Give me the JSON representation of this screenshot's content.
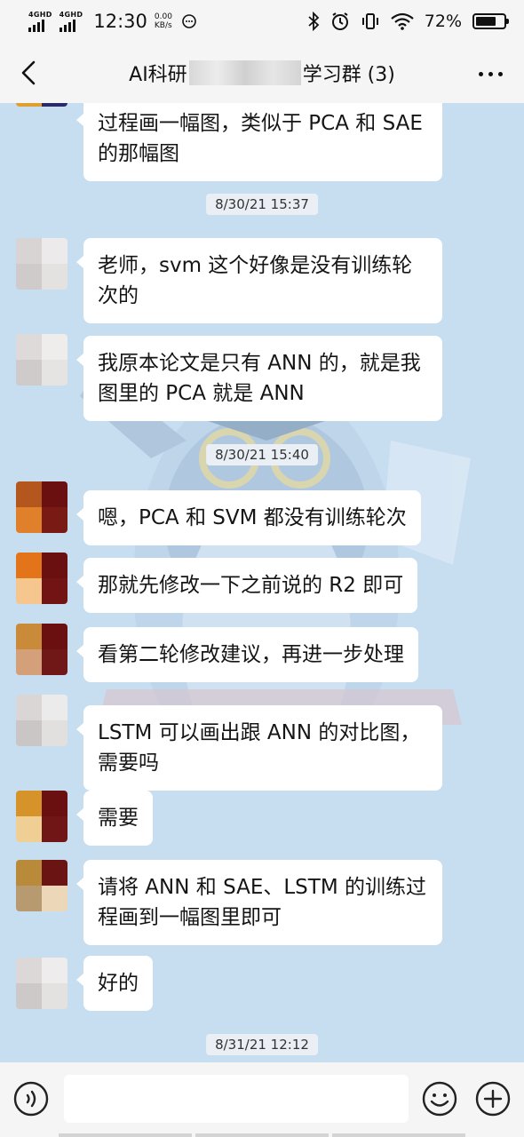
{
  "status_bar": {
    "sim1": "4GHD",
    "sim2": "4GHD",
    "time": "12:30",
    "speed_value": "0.00",
    "speed_unit": "KB/s",
    "battery": "72%",
    "battery_level": 0.72,
    "icons": [
      "bluetooth-icon",
      "alarm-icon",
      "vibrate-icon",
      "wifi-icon",
      "battery-icon"
    ]
  },
  "header": {
    "title_prefix": "AI科研",
    "title_suffix": "学习群 (3)",
    "back_icon": "chevron-left-icon",
    "more_icon": "more-dots-icon"
  },
  "messages": {
    "m0": "过程画一幅图，类似于 PCA 和 SAE 的那幅图",
    "t1": "8/30/21 15:37",
    "m1": "老师，svm 这个好像是没有训练轮次的",
    "m2": "我原本论文是只有 ANN 的，就是我图里的 PCA 就是 ANN",
    "t2": "8/30/21 15:40",
    "m3": "嗯，PCA 和 SVM 都没有训练轮次",
    "m4": "那就先修改一下之前说的 R2 即可",
    "m5": "看第二轮修改建议，再进一步处理",
    "m6": "LSTM 可以画出跟 ANN 的对比图，需要吗",
    "m7": "需要",
    "m8": "请将 ANN 和 SAE、LSTM 的训练过程画到一幅图里即可",
    "m9": "好的",
    "t3": "8/31/21 12:12"
  },
  "input_bar": {
    "placeholder": "",
    "icons": [
      "voice-icon",
      "emoji-icon",
      "plus-icon"
    ]
  },
  "colors": {
    "chat_bg": "#c7ddf0",
    "bubble_bg": "#ffffff",
    "bar_bg": "#f5f5f5"
  }
}
